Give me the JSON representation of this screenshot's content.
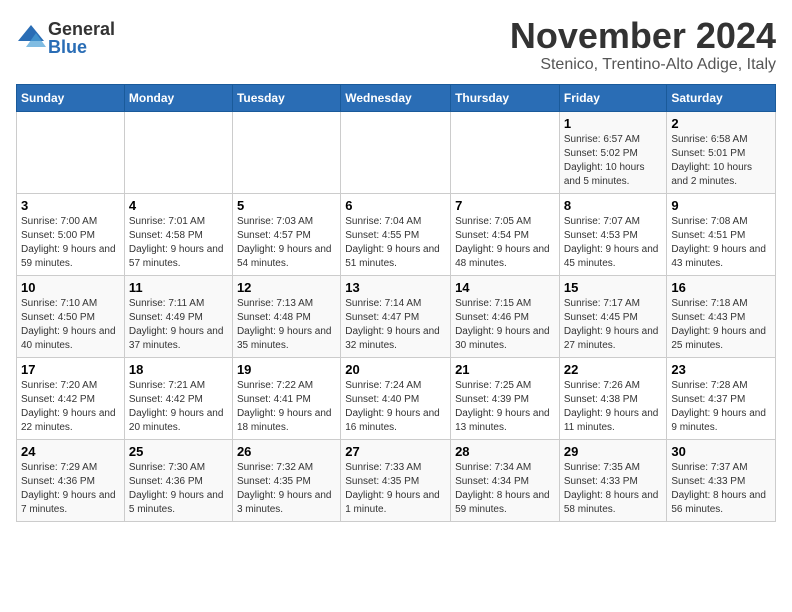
{
  "logo": {
    "general": "General",
    "blue": "Blue"
  },
  "title": "November 2024",
  "subtitle": "Stenico, Trentino-Alto Adige, Italy",
  "headers": [
    "Sunday",
    "Monday",
    "Tuesday",
    "Wednesday",
    "Thursday",
    "Friday",
    "Saturday"
  ],
  "weeks": [
    [
      {
        "day": "",
        "info": ""
      },
      {
        "day": "",
        "info": ""
      },
      {
        "day": "",
        "info": ""
      },
      {
        "day": "",
        "info": ""
      },
      {
        "day": "",
        "info": ""
      },
      {
        "day": "1",
        "info": "Sunrise: 6:57 AM\nSunset: 5:02 PM\nDaylight: 10 hours and 5 minutes."
      },
      {
        "day": "2",
        "info": "Sunrise: 6:58 AM\nSunset: 5:01 PM\nDaylight: 10 hours and 2 minutes."
      }
    ],
    [
      {
        "day": "3",
        "info": "Sunrise: 7:00 AM\nSunset: 5:00 PM\nDaylight: 9 hours and 59 minutes."
      },
      {
        "day": "4",
        "info": "Sunrise: 7:01 AM\nSunset: 4:58 PM\nDaylight: 9 hours and 57 minutes."
      },
      {
        "day": "5",
        "info": "Sunrise: 7:03 AM\nSunset: 4:57 PM\nDaylight: 9 hours and 54 minutes."
      },
      {
        "day": "6",
        "info": "Sunrise: 7:04 AM\nSunset: 4:55 PM\nDaylight: 9 hours and 51 minutes."
      },
      {
        "day": "7",
        "info": "Sunrise: 7:05 AM\nSunset: 4:54 PM\nDaylight: 9 hours and 48 minutes."
      },
      {
        "day": "8",
        "info": "Sunrise: 7:07 AM\nSunset: 4:53 PM\nDaylight: 9 hours and 45 minutes."
      },
      {
        "day": "9",
        "info": "Sunrise: 7:08 AM\nSunset: 4:51 PM\nDaylight: 9 hours and 43 minutes."
      }
    ],
    [
      {
        "day": "10",
        "info": "Sunrise: 7:10 AM\nSunset: 4:50 PM\nDaylight: 9 hours and 40 minutes."
      },
      {
        "day": "11",
        "info": "Sunrise: 7:11 AM\nSunset: 4:49 PM\nDaylight: 9 hours and 37 minutes."
      },
      {
        "day": "12",
        "info": "Sunrise: 7:13 AM\nSunset: 4:48 PM\nDaylight: 9 hours and 35 minutes."
      },
      {
        "day": "13",
        "info": "Sunrise: 7:14 AM\nSunset: 4:47 PM\nDaylight: 9 hours and 32 minutes."
      },
      {
        "day": "14",
        "info": "Sunrise: 7:15 AM\nSunset: 4:46 PM\nDaylight: 9 hours and 30 minutes."
      },
      {
        "day": "15",
        "info": "Sunrise: 7:17 AM\nSunset: 4:45 PM\nDaylight: 9 hours and 27 minutes."
      },
      {
        "day": "16",
        "info": "Sunrise: 7:18 AM\nSunset: 4:43 PM\nDaylight: 9 hours and 25 minutes."
      }
    ],
    [
      {
        "day": "17",
        "info": "Sunrise: 7:20 AM\nSunset: 4:42 PM\nDaylight: 9 hours and 22 minutes."
      },
      {
        "day": "18",
        "info": "Sunrise: 7:21 AM\nSunset: 4:42 PM\nDaylight: 9 hours and 20 minutes."
      },
      {
        "day": "19",
        "info": "Sunrise: 7:22 AM\nSunset: 4:41 PM\nDaylight: 9 hours and 18 minutes."
      },
      {
        "day": "20",
        "info": "Sunrise: 7:24 AM\nSunset: 4:40 PM\nDaylight: 9 hours and 16 minutes."
      },
      {
        "day": "21",
        "info": "Sunrise: 7:25 AM\nSunset: 4:39 PM\nDaylight: 9 hours and 13 minutes."
      },
      {
        "day": "22",
        "info": "Sunrise: 7:26 AM\nSunset: 4:38 PM\nDaylight: 9 hours and 11 minutes."
      },
      {
        "day": "23",
        "info": "Sunrise: 7:28 AM\nSunset: 4:37 PM\nDaylight: 9 hours and 9 minutes."
      }
    ],
    [
      {
        "day": "24",
        "info": "Sunrise: 7:29 AM\nSunset: 4:36 PM\nDaylight: 9 hours and 7 minutes."
      },
      {
        "day": "25",
        "info": "Sunrise: 7:30 AM\nSunset: 4:36 PM\nDaylight: 9 hours and 5 minutes."
      },
      {
        "day": "26",
        "info": "Sunrise: 7:32 AM\nSunset: 4:35 PM\nDaylight: 9 hours and 3 minutes."
      },
      {
        "day": "27",
        "info": "Sunrise: 7:33 AM\nSunset: 4:35 PM\nDaylight: 9 hours and 1 minute."
      },
      {
        "day": "28",
        "info": "Sunrise: 7:34 AM\nSunset: 4:34 PM\nDaylight: 8 hours and 59 minutes."
      },
      {
        "day": "29",
        "info": "Sunrise: 7:35 AM\nSunset: 4:33 PM\nDaylight: 8 hours and 58 minutes."
      },
      {
        "day": "30",
        "info": "Sunrise: 7:37 AM\nSunset: 4:33 PM\nDaylight: 8 hours and 56 minutes."
      }
    ]
  ]
}
